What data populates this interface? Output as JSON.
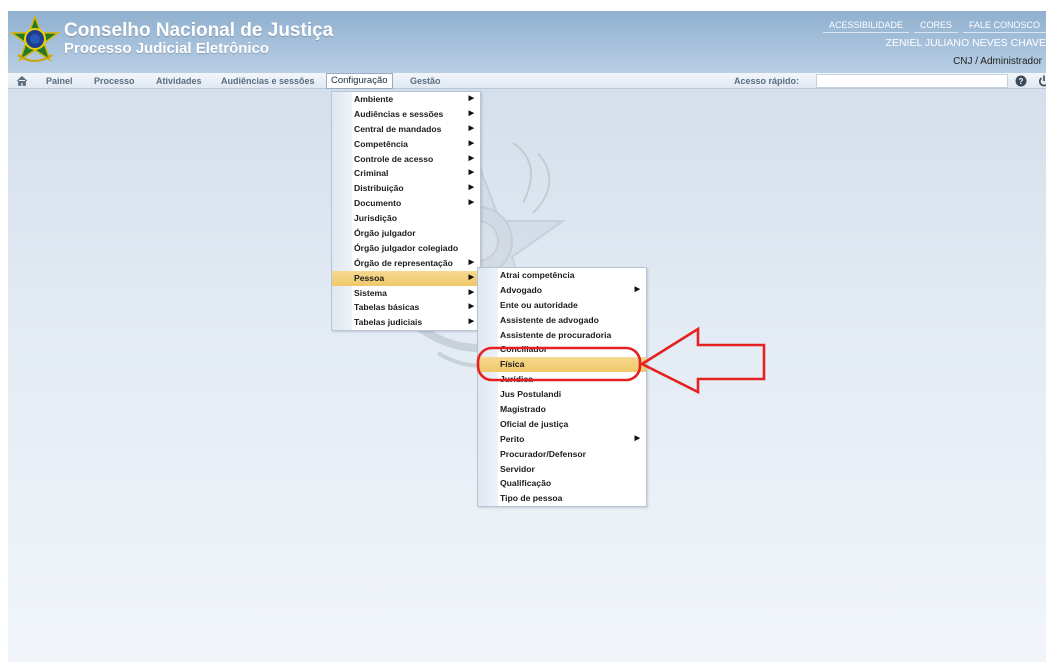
{
  "header": {
    "title": "Conselho Nacional de Justiça",
    "subtitle": "Processo Judicial Eletrônico",
    "links": [
      "ACESSIBILIDADE",
      "CORES",
      "FALE CONOSCO"
    ],
    "user_name": "ZENIEL JULIANO NEVES CHAVE",
    "user_role": "CNJ / Administrador"
  },
  "menubar": {
    "items": [
      "Painel",
      "Processo",
      "Atividades",
      "Audiências e sessões",
      "Configuração",
      "Gestão"
    ],
    "quick_access_label": "Acesso rápido:"
  },
  "config_menu": {
    "items": [
      {
        "label": "Ambiente",
        "submenu": true
      },
      {
        "label": "Audiências e sessões",
        "submenu": true
      },
      {
        "label": "Central de mandados",
        "submenu": true
      },
      {
        "label": "Competência",
        "submenu": true
      },
      {
        "label": "Controle de acesso",
        "submenu": true
      },
      {
        "label": "Criminal",
        "submenu": true
      },
      {
        "label": "Distribuição",
        "submenu": true
      },
      {
        "label": "Documento",
        "submenu": true
      },
      {
        "label": "Jurisdição",
        "submenu": false
      },
      {
        "label": "Órgão julgador",
        "submenu": false
      },
      {
        "label": "Órgão julgador colegiado",
        "submenu": false
      },
      {
        "label": "Órgão de representação",
        "submenu": true
      },
      {
        "label": "Pessoa",
        "submenu": true,
        "highlighted": true
      },
      {
        "label": "Sistema",
        "submenu": true
      },
      {
        "label": "Tabelas básicas",
        "submenu": true
      },
      {
        "label": "Tabelas judiciais",
        "submenu": true
      }
    ]
  },
  "pessoa_menu": {
    "items": [
      {
        "label": "Atrai competência",
        "submenu": false
      },
      {
        "label": "Advogado",
        "submenu": true
      },
      {
        "label": "Ente ou autoridade",
        "submenu": false
      },
      {
        "label": "Assistente de advogado",
        "submenu": false
      },
      {
        "label": "Assistente de procuradoria",
        "submenu": false
      },
      {
        "label": "Conciliador",
        "submenu": false
      },
      {
        "label": "Física",
        "submenu": false,
        "highlighted": true
      },
      {
        "label": "Jurídica",
        "submenu": false
      },
      {
        "label": "Jus Postulandi",
        "submenu": false
      },
      {
        "label": "Magistrado",
        "submenu": false
      },
      {
        "label": "Oficial de justiça",
        "submenu": false
      },
      {
        "label": "Perito",
        "submenu": true
      },
      {
        "label": "Procurador/Defensor",
        "submenu": false
      },
      {
        "label": "Servidor",
        "submenu": false
      },
      {
        "label": "Qualificação",
        "submenu": false
      },
      {
        "label": "Tipo de pessoa",
        "submenu": false
      }
    ]
  },
  "colors": {
    "header": "#a8c2dc",
    "highlight": "#f3d27e",
    "annotation": "#e52222"
  },
  "icons": [
    "brasao-logo-icon",
    "home-icon",
    "help-icon",
    "power-icon",
    "submenu-arrow-icon"
  ]
}
